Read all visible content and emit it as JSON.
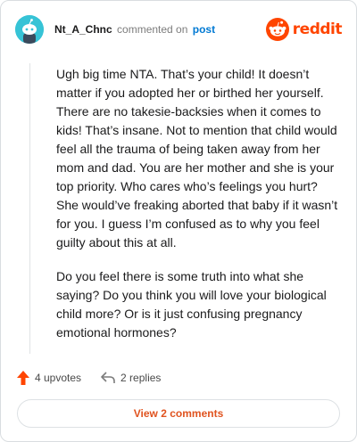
{
  "comment": {
    "username": "Nt_A_Chnc",
    "verb": "commented on",
    "post_link": "post",
    "brand": "reddit",
    "paragraphs": [
      "Ugh big time NTA. That’s your child! It doesn’t matter if you adopted her or birthed her yourself. There are no takesie-backsies when it comes to kids! That’s insane. Not to mention that child would feel all the trauma of being taken away from her mom and dad. You are her mother and she is your top priority. Who cares who’s feelings you hurt? She would’ve freaking aborted that baby if it wasn’t for you. I guess I’m confused as to why you feel guilty about this at all.",
      "Do you feel there is some truth into what she saying? Do you think you will love your biological child more? Or is it just confusing pregnancy emotional hormones?"
    ],
    "upvotes": "4 upvotes",
    "replies": "2 replies",
    "view_comments": "View 2 comments"
  },
  "colors": {
    "brand": "#ff4500",
    "link": "#0079d3",
    "avatar_bg": "#36c3d6",
    "button_text": "#e0531f"
  },
  "icons": {
    "avatar": "snoo-avatar-icon",
    "logo": "reddit-logo-icon",
    "upvote": "upvote-arrow-icon",
    "reply": "reply-arrow-icon"
  }
}
